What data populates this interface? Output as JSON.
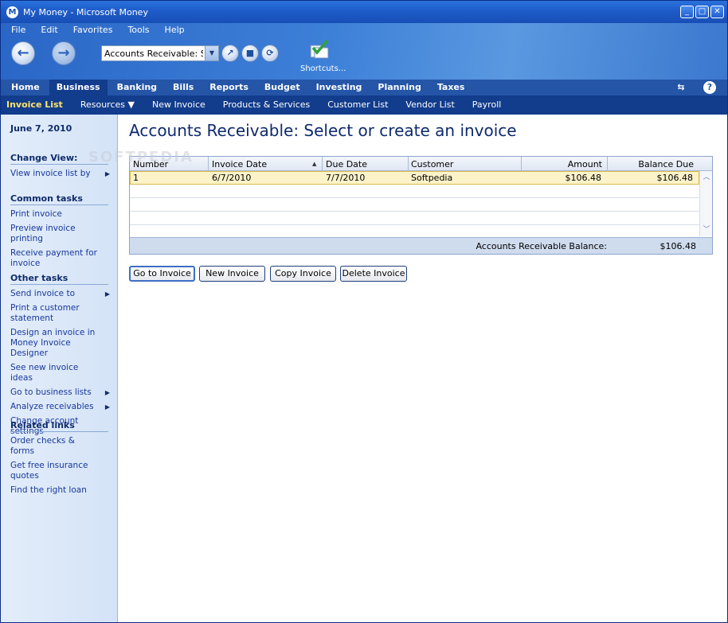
{
  "window": {
    "title": "My Money - Microsoft Money",
    "app_icon": "M"
  },
  "menubar": [
    "File",
    "Edit",
    "Favorites",
    "Tools",
    "Help"
  ],
  "toolbar": {
    "address_value": "Accounts Receivable: Select or create an invoice",
    "shortcuts_label": "Shortcuts..."
  },
  "tabs": [
    "Home",
    "Business",
    "Banking",
    "Bills",
    "Reports",
    "Budget",
    "Investing",
    "Planning",
    "Taxes"
  ],
  "active_tab": "Business",
  "subnav": [
    "Invoice List",
    "Resources ▼",
    "New Invoice",
    "Products & Services",
    "Customer List",
    "Vendor List",
    "Payroll"
  ],
  "sidebar": {
    "date": "June 7, 2010",
    "change_view": {
      "title": "Change View:",
      "items": [
        "View invoice list by"
      ]
    },
    "common_tasks": {
      "title": "Common tasks",
      "items": [
        "Print invoice",
        "Preview invoice printing",
        "Receive payment for invoice"
      ]
    },
    "other_tasks": {
      "title": "Other tasks",
      "items": [
        "Send invoice to",
        "Print a customer statement",
        "Design an invoice in Money Invoice Designer",
        "See new invoice ideas",
        "Go to business lists",
        "Analyze receivables",
        "Change account settings"
      ]
    },
    "related_links": {
      "title": "Related links",
      "items": [
        "Order checks & forms",
        "Get free insurance quotes",
        "Find the right loan"
      ]
    }
  },
  "main": {
    "title": "Accounts Receivable: Select or create an invoice",
    "columns": [
      "Number",
      "Invoice Date",
      "Due Date",
      "Customer",
      "Amount",
      "Balance Due"
    ],
    "rows": [
      {
        "number": "1",
        "invoice_date": "6/7/2010",
        "due_date": "7/7/2010",
        "customer": "Softpedia",
        "amount": "$106.48",
        "balance_due": "$106.48"
      }
    ],
    "footer_label": "Accounts Receivable Balance:",
    "footer_value": "$106.48",
    "buttons": [
      "Go to Invoice",
      "New Invoice",
      "Copy Invoice",
      "Delete Invoice"
    ]
  },
  "watermark": "SOFTPEDIA",
  "colors": {
    "accent": "#123c8c",
    "selected_row": "#fdf3c9",
    "highlight_text": "#ffe56b"
  }
}
